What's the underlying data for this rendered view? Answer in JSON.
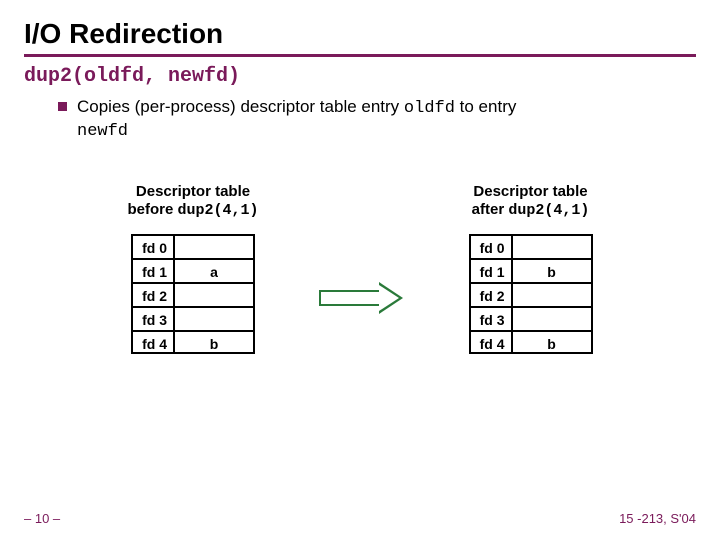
{
  "title": "I/O Redirection",
  "subtitle": "dup2(oldfd, newfd)",
  "bullet": {
    "pre": "Copies (per-process) descriptor table entry ",
    "mono1": "oldfd",
    "mid": " to entry ",
    "mono2": "newfd"
  },
  "before": {
    "caption_line1": "Descriptor table",
    "caption_line2_pre": "before ",
    "caption_line2_mono": "dup2(4,1)",
    "rows": [
      {
        "label": "fd 0",
        "value": ""
      },
      {
        "label": "fd 1",
        "value": "a"
      },
      {
        "label": "fd 2",
        "value": ""
      },
      {
        "label": "fd 3",
        "value": ""
      },
      {
        "label": "fd 4",
        "value": "b"
      }
    ]
  },
  "after": {
    "caption_line1": "Descriptor table",
    "caption_line2_pre": "after ",
    "caption_line2_mono": "dup2(4,1)",
    "rows": [
      {
        "label": "fd 0",
        "value": ""
      },
      {
        "label": "fd 1",
        "value": "b"
      },
      {
        "label": "fd 2",
        "value": ""
      },
      {
        "label": "fd 3",
        "value": ""
      },
      {
        "label": "fd 4",
        "value": "b"
      }
    ]
  },
  "footer": {
    "left": "– 10 –",
    "right": "15 -213, S'04"
  },
  "colors": {
    "accent": "#7a1a5a",
    "arrow": "#2a7a3a"
  }
}
